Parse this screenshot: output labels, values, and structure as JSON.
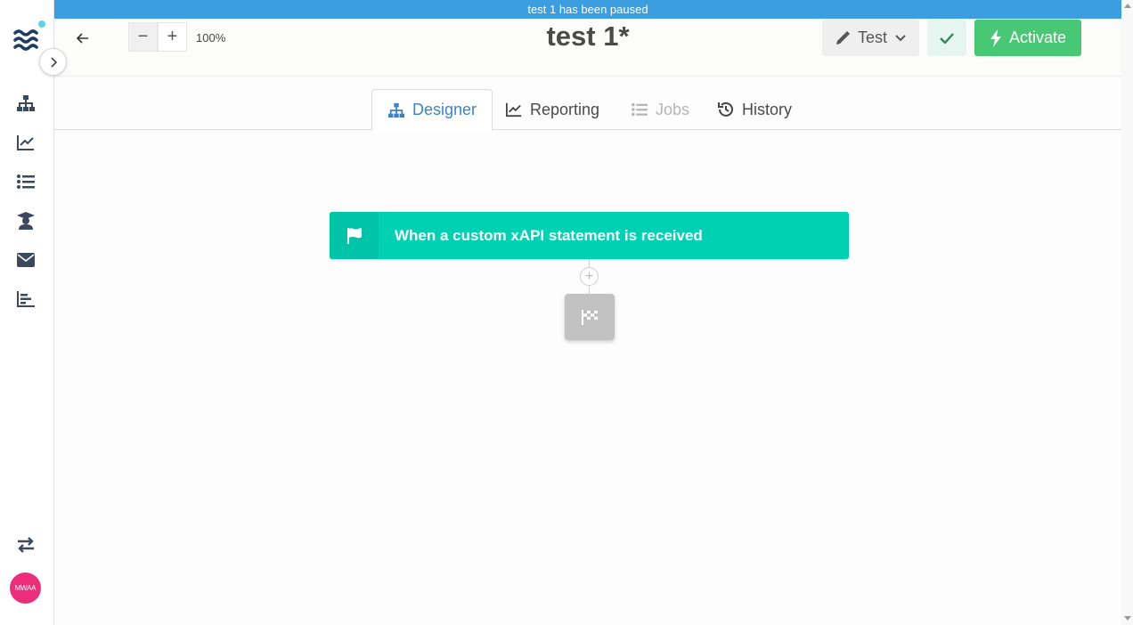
{
  "banner": {
    "text": "test 1 has been paused"
  },
  "header": {
    "title": "test 1*",
    "zoom_level": "100%",
    "zoom_out": "−",
    "zoom_in": "+",
    "test_label": "Test",
    "activate_label": "Activate"
  },
  "tabs": [
    {
      "label": "Designer",
      "state": "active"
    },
    {
      "label": "Reporting",
      "state": "normal"
    },
    {
      "label": "Jobs",
      "state": "disabled"
    },
    {
      "label": "History",
      "state": "normal"
    }
  ],
  "sidebar": {
    "avatar_initials": "MWAA",
    "icons": [
      "logo-icon",
      "sitemap-icon",
      "chart-line-icon",
      "list-icon",
      "graduate-icon",
      "envelope-icon",
      "bar-chart-icon",
      "swap-icon"
    ]
  },
  "canvas": {
    "trigger_label": "When a custom xAPI statement is received",
    "add_step_symbol": "+"
  },
  "colors": {
    "banner": "#3a9ee0",
    "trigger": "#00d1b2",
    "activate": "#48c774",
    "avatar": "#ec2d7a",
    "active_tab": "#3b84c4"
  }
}
